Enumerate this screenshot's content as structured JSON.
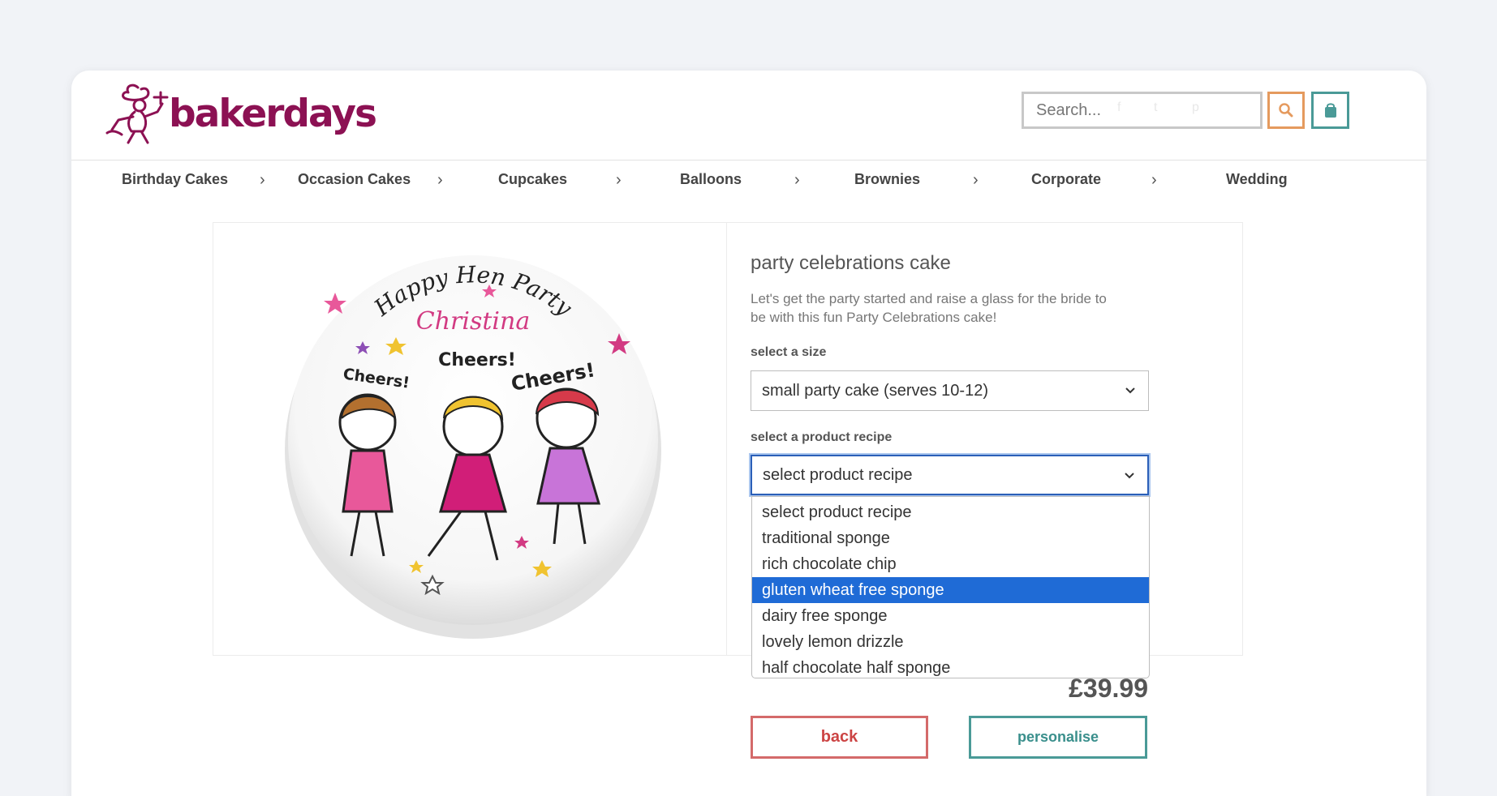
{
  "brand": {
    "name": "bakerdays",
    "color": "#8c1153"
  },
  "search": {
    "placeholder": "Search...",
    "icon": "search-icon"
  },
  "cart": {
    "icon": "shopping-bag-icon"
  },
  "nav": {
    "items": [
      {
        "label": "Birthday Cakes"
      },
      {
        "label": "Occasion Cakes"
      },
      {
        "label": "Cupcakes"
      },
      {
        "label": "Balloons"
      },
      {
        "label": "Brownies"
      },
      {
        "label": "Corporate"
      },
      {
        "label": "Wedding"
      }
    ]
  },
  "cake_image": {
    "heading": "Happy Hen Party",
    "name": "Christina",
    "cheers": [
      "Cheers!",
      "Cheers!",
      "Cheers!"
    ]
  },
  "product": {
    "title": "party celebrations cake",
    "description": "Let's get the party started and raise a glass for the bride to be with this fun Party Celebrations cake!",
    "share_icons": [
      "facebook-icon",
      "twitter-icon",
      "pinterest-icon"
    ],
    "size_label": "select a size",
    "size_value": "small party cake (serves 10-12)",
    "recipe_label": "select a product recipe",
    "recipe_value": "select product recipe",
    "recipe_options": [
      "select product recipe",
      "traditional sponge",
      "rich chocolate chip",
      "gluten wheat free sponge",
      "dairy free sponge",
      "lovely lemon drizzle",
      "half chocolate half sponge"
    ],
    "highlighted_option": "gluten wheat free sponge",
    "price": "£39.99",
    "back_label": "back",
    "personalise_label": "personalise"
  },
  "colors": {
    "search_border": "#e59a5e",
    "accent_teal": "#4a9a97",
    "back_red": "#d46a6a",
    "highlight_blue": "#1f6bd6"
  }
}
